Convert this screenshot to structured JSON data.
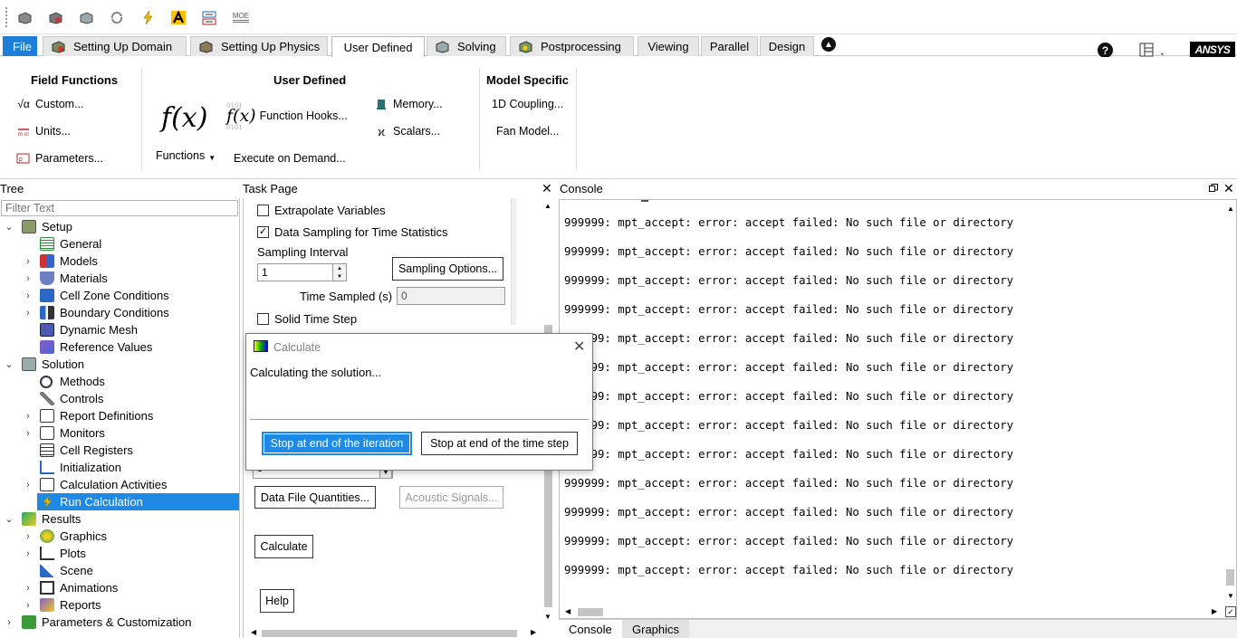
{
  "ribbon_tabs": {
    "file": "File",
    "setting_up_domain": "Setting Up Domain",
    "setting_up_physics": "Setting Up Physics",
    "user_defined": "User Defined",
    "solving": "Solving",
    "postprocessing": "Postprocessing",
    "viewing": "Viewing",
    "parallel": "Parallel",
    "design": "Design"
  },
  "brand": "ANSYS",
  "quick_access": {
    "moe_label": "MOE"
  },
  "ribbon": {
    "field_functions": {
      "title": "Field Functions",
      "custom": "Custom...",
      "units": "Units...",
      "parameters": "Parameters..."
    },
    "user_defined": {
      "title": "User Defined",
      "functions": "Functions",
      "function_hooks": "Function Hooks...",
      "execute_on_demand": "Execute on Demand...",
      "memory": "Memory...",
      "scalars": "Scalars..."
    },
    "model_specific": {
      "title": "Model Specific",
      "coupling_1d": "1D Coupling...",
      "fan_model": "Fan Model..."
    }
  },
  "tree": {
    "header": "Tree",
    "filter_placeholder": "Filter Text",
    "items": [
      {
        "label": "Setup"
      },
      {
        "label": "General"
      },
      {
        "label": "Models"
      },
      {
        "label": "Materials"
      },
      {
        "label": "Cell Zone Conditions"
      },
      {
        "label": "Boundary Conditions"
      },
      {
        "label": "Dynamic Mesh"
      },
      {
        "label": "Reference Values"
      },
      {
        "label": "Solution"
      },
      {
        "label": "Methods"
      },
      {
        "label": "Controls"
      },
      {
        "label": "Report Definitions"
      },
      {
        "label": "Monitors"
      },
      {
        "label": "Cell Registers"
      },
      {
        "label": "Initialization"
      },
      {
        "label": "Calculation Activities"
      },
      {
        "label": "Run Calculation"
      },
      {
        "label": "Results"
      },
      {
        "label": "Graphics"
      },
      {
        "label": "Plots"
      },
      {
        "label": "Scene"
      },
      {
        "label": "Animations"
      },
      {
        "label": "Reports"
      },
      {
        "label": "Parameters & Customization"
      }
    ]
  },
  "task_page": {
    "header": "Task Page",
    "extrapolate_variables": "Extrapolate Variables",
    "data_sampling": "Data Sampling for Time Statistics",
    "sampling_interval_label": "Sampling Interval",
    "sampling_interval_value": "1",
    "sampling_options": "Sampling Options...",
    "time_sampled_label": "Time Sampled (s)",
    "time_sampled_value": "0",
    "solid_time_step": "Solid Time Step",
    "hidden_select_value": "3",
    "data_file_quantities": "Data File Quantities...",
    "acoustic_signals": "Acoustic Signals...",
    "calculate": "Calculate",
    "help": "Help"
  },
  "dialog": {
    "title": "Calculate",
    "message": "Calculating the solution...",
    "stop_iteration": "Stop at end of the iteration",
    "stop_time_step": "Stop at end of the time step"
  },
  "console": {
    "header": "Console",
    "lines": [
      "999999: mpt_accept: error: accept failed: No such file or directory",
      "999999: mpt_accept: error: accept failed: No such file or directory",
      "999999: mpt_accept: error: accept failed: No such file or directory",
      "999999: mpt_accept: error: accept failed: No such file or directory",
      "999999: mpt_accept: error: accept failed: No such file or directory",
      "999999: mpt_accept: error: accept failed: No such file or directory",
      "999999: mpt_accept: error: accept failed: No such file or directory",
      "999999: mpt_accept: error: accept failed: No such file or directory",
      "999999: mpt_accept: error: accept failed: No such file or directory",
      "999999: mpt_accept: error: accept failed: No such file or directory",
      "999999: mpt_accept: error: accept failed: No such file or directory",
      "999999: mpt_accept: error: accept failed: No such file or directory",
      "999999: mpt_accept: error: accept failed: No such file or directory"
    ],
    "tabs": {
      "console": "Console",
      "graphics": "Graphics"
    }
  }
}
